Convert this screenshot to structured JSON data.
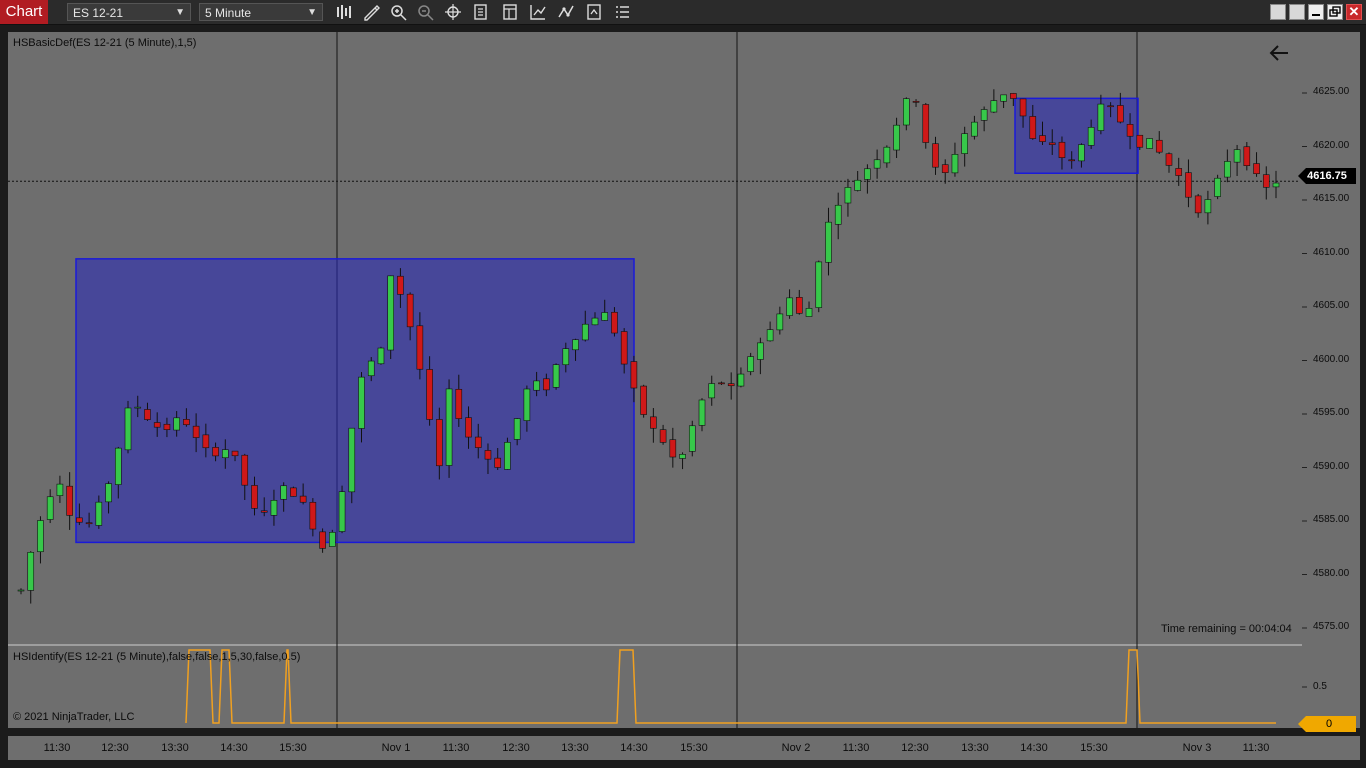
{
  "toolbar": {
    "tab_label": "Chart",
    "instrument": "ES 12-21",
    "interval": "5 Minute",
    "tools": [
      "bar-type-icon",
      "draw-tool-icon",
      "zoom-in-icon",
      "zoom-out-icon",
      "crosshair-icon",
      "data-box-icon",
      "templates-icon",
      "strategies-icon",
      "indicators-icon",
      "properties-icon",
      "more-icon"
    ]
  },
  "main_panel": {
    "indicator_label": "HSBasicDef(ES 12-21 (5 Minute),1,5)",
    "time_remaining": "Time remaining = 00:04:04",
    "last_price": "4616.75",
    "price_ticks": [
      "4625.00",
      "4620.00",
      "4615.00",
      "4610.00",
      "4605.00",
      "4600.00",
      "4595.00",
      "4590.00",
      "4585.00",
      "4580.00",
      "4575.00"
    ]
  },
  "lower_panel": {
    "indicator_label": "HSIdentify(ES 12-21 (5 Minute),false,false,1,5,30,false,0.5)",
    "copyright": "© 2021 NinjaTrader, LLC",
    "tick": "0.5",
    "current_value": "0"
  },
  "x_axis": {
    "ticks": [
      "11:30",
      "12:30",
      "13:30",
      "14:30",
      "15:30",
      "Nov 1",
      "11:30",
      "12:30",
      "13:30",
      "14:30",
      "15:30",
      "Nov 2",
      "11:30",
      "12:30",
      "13:30",
      "14:30",
      "15:30",
      "Nov 3",
      "11:30"
    ]
  },
  "chart_data": {
    "type": "candlestick",
    "instrument": "ES 12-21",
    "interval": "5 Minute",
    "ylim": [
      4573,
      4628
    ],
    "up_color": "#37c84a",
    "down_color": "#d01818",
    "box_color": "#1a1ad8",
    "signal_color": "#f0a020",
    "session_dividers": [
      "Oct 29 close",
      "Nov 1 close",
      "Nov 2 close"
    ],
    "close_path": [
      [
        0,
        4578.5
      ],
      [
        5,
        4582
      ],
      [
        10,
        4585
      ],
      [
        15,
        4587.5
      ],
      [
        20,
        4589
      ],
      [
        25,
        4586
      ],
      [
        30,
        4585
      ],
      [
        35,
        4584.5
      ],
      [
        40,
        4586
      ],
      [
        45,
        4588
      ],
      [
        50,
        4591
      ],
      [
        55,
        4595
      ],
      [
        60,
        4596
      ],
      [
        65,
        4595
      ],
      [
        70,
        4594
      ],
      [
        75,
        4593.5
      ],
      [
        80,
        4594
      ],
      [
        85,
        4595
      ],
      [
        90,
        4593
      ],
      [
        95,
        4592
      ],
      [
        100,
        4591
      ],
      [
        105,
        4592
      ],
      [
        110,
        4591.5
      ],
      [
        115,
        4590
      ],
      [
        120,
        4587
      ],
      [
        125,
        4585
      ],
      [
        130,
        4586
      ],
      [
        135,
        4588
      ],
      [
        140,
        4588
      ],
      [
        145,
        4587.5
      ],
      [
        150,
        4586
      ],
      [
        155,
        4584
      ],
      [
        160,
        4582
      ],
      [
        165,
        4585
      ],
      [
        170,
        4589
      ],
      [
        175,
        4595
      ],
      [
        180,
        4599
      ],
      [
        185,
        4600
      ],
      [
        190,
        4601
      ],
      [
        195,
        4609
      ],
      [
        200,
        4606
      ],
      [
        205,
        4603
      ],
      [
        210,
        4599
      ],
      [
        215,
        4594
      ],
      [
        220,
        4590
      ],
      [
        225,
        4597
      ],
      [
        230,
        4595
      ],
      [
        235,
        4593
      ],
      [
        240,
        4592
      ],
      [
        245,
        4591
      ],
      [
        250,
        4590
      ],
      [
        255,
        4592
      ],
      [
        260,
        4594
      ],
      [
        265,
        4597
      ],
      [
        270,
        4598
      ],
      [
        275,
        4597
      ],
      [
        280,
        4599
      ],
      [
        285,
        4601
      ],
      [
        290,
        4602
      ],
      [
        295,
        4603
      ],
      [
        300,
        4604
      ],
      [
        305,
        4604.5
      ],
      [
        310,
        4604
      ],
      [
        315,
        4601
      ],
      [
        320,
        4598
      ],
      [
        325,
        4596
      ],
      [
        330,
        4594
      ],
      [
        335,
        4593
      ],
      [
        340,
        4592
      ],
      [
        345,
        4590
      ],
      [
        350,
        4592
      ],
      [
        355,
        4595
      ],
      [
        360,
        4597
      ],
      [
        365,
        4598
      ],
      [
        370,
        4598
      ],
      [
        375,
        4597
      ],
      [
        380,
        4599
      ],
      [
        385,
        4601
      ],
      [
        390,
        4602
      ],
      [
        395,
        4603
      ],
      [
        400,
        4605
      ],
      [
        405,
        4606
      ],
      [
        410,
        4604
      ],
      [
        415,
        4605
      ],
      [
        420,
        4610
      ],
      [
        425,
        4613
      ],
      [
        430,
        4615
      ],
      [
        435,
        4616
      ],
      [
        440,
        4617
      ],
      [
        445,
        4618
      ],
      [
        450,
        4619
      ],
      [
        455,
        4620
      ],
      [
        460,
        4622
      ],
      [
        465,
        4624
      ],
      [
        470,
        4625
      ],
      [
        475,
        4621
      ],
      [
        480,
        4618
      ],
      [
        485,
        4617
      ],
      [
        490,
        4619
      ],
      [
        495,
        4621
      ],
      [
        500,
        4622
      ],
      [
        505,
        4623
      ],
      [
        510,
        4624
      ],
      [
        515,
        4625
      ],
      [
        520,
        4625
      ],
      [
        525,
        4624
      ],
      [
        530,
        4621
      ],
      [
        535,
        4620
      ],
      [
        540,
        4620.5
      ],
      [
        545,
        4620
      ],
      [
        550,
        4618
      ],
      [
        555,
        4619
      ],
      [
        560,
        4621
      ],
      [
        565,
        4623
      ],
      [
        570,
        4624
      ],
      [
        575,
        4623
      ],
      [
        580,
        4622
      ],
      [
        585,
        4621
      ],
      [
        590,
        4620
      ],
      [
        595,
        4620.5
      ],
      [
        600,
        4619
      ],
      [
        605,
        4618
      ],
      [
        610,
        4617
      ],
      [
        615,
        4615
      ],
      [
        620,
        4614
      ],
      [
        625,
        4615
      ],
      [
        630,
        4617
      ],
      [
        635,
        4619
      ],
      [
        640,
        4620
      ],
      [
        645,
        4618.5
      ],
      [
        650,
        4617
      ],
      [
        655,
        4616
      ],
      [
        660,
        4616.75
      ]
    ],
    "boxes": [
      {
        "from": "Oct 29 11:55",
        "to": "Nov 1 14:30",
        "high": 4609.5,
        "low": 4583
      },
      {
        "from": "Nov 2 14:15",
        "to": "Nov 2 15:55",
        "high": 4624.5,
        "low": 4617.5
      }
    ],
    "signal_series": {
      "name": "HSIdentify",
      "baseline": 0,
      "pulses": [
        {
          "start": "Oct 29 13:35",
          "end": "Oct 29 14:00",
          "value": 1
        },
        {
          "start": "Oct 29 14:05",
          "end": "Oct 29 14:15",
          "value": 1
        },
        {
          "start": "Oct 29 15:20",
          "end": "Oct 29 15:30",
          "value": 1
        },
        {
          "start": "Nov 1 14:15",
          "end": "Nov 1 14:30",
          "value": 1
        },
        {
          "start": "Nov 2 16:00",
          "end": "Nov 2 16:10",
          "value": 1
        }
      ]
    }
  }
}
